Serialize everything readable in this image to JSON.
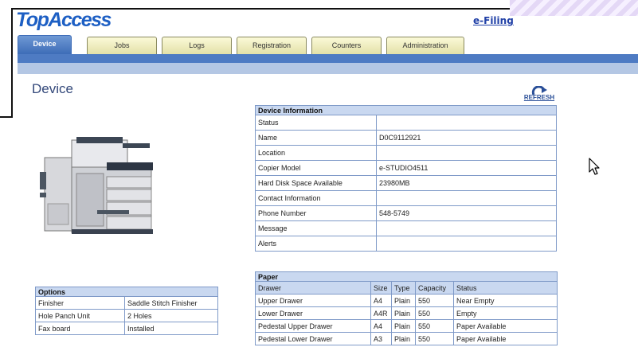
{
  "app": {
    "logo": "TopAccess",
    "efiling_link": "e-Filing"
  },
  "tabs": [
    {
      "label": "Device",
      "active": true
    },
    {
      "label": "Jobs"
    },
    {
      "label": "Logs"
    },
    {
      "label": "Registration"
    },
    {
      "label": "Counters"
    },
    {
      "label": "Administration"
    }
  ],
  "page": {
    "title": "Device",
    "refresh_label": "REFRESH"
  },
  "device_info": {
    "header": "Device Information",
    "rows": [
      {
        "label": "Status",
        "value": ""
      },
      {
        "label": "Name",
        "value": "D0C9112921"
      },
      {
        "label": "Location",
        "value": ""
      },
      {
        "label": "Copier Model",
        "value": "e-STUDIO4511"
      },
      {
        "label": "Hard Disk Space Available",
        "value": "23980MB"
      },
      {
        "label": "Contact Information",
        "value": ""
      },
      {
        "label": "Phone Number",
        "value": "548-5749"
      },
      {
        "label": "Message",
        "value": ""
      },
      {
        "label": "Alerts",
        "value": ""
      }
    ]
  },
  "paper": {
    "header": "Paper",
    "columns": [
      "Drawer",
      "Size",
      "Type",
      "Capacity",
      "Status"
    ],
    "rows": [
      [
        "Upper Drawer",
        "A4",
        "Plain",
        "550",
        "Near Empty"
      ],
      [
        "Lower Drawer",
        "A4R",
        "Plain",
        "550",
        "Empty"
      ],
      [
        "Pedestal Upper Drawer",
        "A4",
        "Plain",
        "550",
        "Paper Available"
      ],
      [
        "Pedestal Lower Drawer",
        "A3",
        "Plain",
        "550",
        "Paper Available"
      ]
    ]
  },
  "options": {
    "header": "Options",
    "rows": [
      {
        "label": "Finisher",
        "value": "Saddle Stitch Finisher"
      },
      {
        "label": "Hole Panch Unit",
        "value": "2 Holes"
      },
      {
        "label": "Fax board",
        "value": "Installed"
      }
    ]
  },
  "colors": {
    "brand": "#1d5fc4",
    "tab_active": "#3d6cb7",
    "tab_inactive": "#f3f1c4",
    "table_header": "#c9d8f0",
    "table_border": "#7f9ac8"
  },
  "icons": {
    "refresh": "refresh-arrow-icon",
    "device": "copier-image",
    "cursor": "mouse-pointer-icon"
  }
}
